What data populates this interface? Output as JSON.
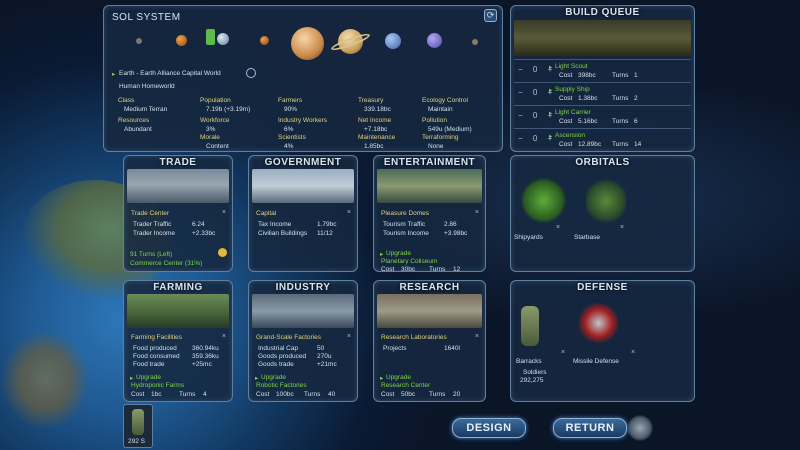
{
  "sol": {
    "title": "SOL SYSTEM",
    "planet_line": "Earth - Earth Alliance Capital World",
    "sub": "Human Homeworld",
    "stats": [
      {
        "l": "Class",
        "v": "Medium Terran"
      },
      {
        "l": "Population",
        "v": "7.19b (+3.19m)"
      },
      {
        "l": "Farmers",
        "v": "90%"
      },
      {
        "l": "Treasury",
        "v": "339.18bc"
      },
      {
        "l": "Ecology Control",
        "v": "Maintain"
      },
      {
        "l": "Resources",
        "v": "Abundant"
      },
      {
        "l": "Workforce",
        "v": "3%"
      },
      {
        "l": "Industry Workers",
        "v": "6%"
      },
      {
        "l": "Net Income",
        "v": "+7.18bc"
      },
      {
        "l": "Pollution",
        "v": "549u (Medium)"
      },
      {
        "l": "",
        "v": ""
      },
      {
        "l": "Morale",
        "v": "Content"
      },
      {
        "l": "Scientists",
        "v": "4%"
      },
      {
        "l": "Maintenance",
        "v": "1.85bc"
      },
      {
        "l": "Terraforming",
        "v": "None"
      }
    ]
  },
  "build": {
    "title": "BUILD QUEUE",
    "items": [
      {
        "name": "Light Scout",
        "cost": "Cost",
        "cv": "398bc",
        "turns": "Turns",
        "tv": "1",
        "ctl": "− 0 +"
      },
      {
        "name": "Supply Ship",
        "cost": "Cost",
        "cv": "1.38bc",
        "turns": "Turns",
        "tv": "2",
        "ctl": "− 0 +"
      },
      {
        "name": "Light Carrier",
        "cost": "Cost",
        "cv": "5.16bc",
        "turns": "Turns",
        "tv": "6",
        "ctl": "− 0 +"
      },
      {
        "name": "Ascension",
        "cost": "Cost",
        "cv": "12.89bc",
        "turns": "Turns",
        "tv": "14",
        "ctl": "− 0 +"
      }
    ]
  },
  "trade": {
    "title": "TRADE",
    "facility": "Trade Center",
    "r1l": "Trader Traffic",
    "r1v": "6.24",
    "r2l": "Trader Income",
    "r2v": "+2.33bc",
    "extra1": "91 Turns (Left)",
    "extra2": "Commerce Center (31%)"
  },
  "gov": {
    "title": "GOVERNMENT",
    "facility": "Capital",
    "r1l": "Tax Income",
    "r1v": "1.79bc",
    "r2l": "Civilian Buildings",
    "r2v": "11/12"
  },
  "ent": {
    "title": "ENTERTAINMENT",
    "facility": "Pleasure Domes",
    "r1l": "Tourism Traffic",
    "r1v": "2.86",
    "r2l": "Tourism Income",
    "r2v": "+3.98bc",
    "up": "Upgrade",
    "upname": "Planetary Coliseum",
    "cost": "Cost",
    "cv": "30bc",
    "turns": "Turns",
    "tv": "12"
  },
  "orb": {
    "title": "ORBITALS",
    "a": "Shipyards",
    "b": "Starbase"
  },
  "farm": {
    "title": "FARMING",
    "facility": "Farming Facilities",
    "r1l": "Food produced",
    "r1v": "360.94ku",
    "r2l": "Food consumed",
    "r2v": "359.36ku",
    "r3l": "Food trade",
    "r3v": "+25mc",
    "up": "Upgrade",
    "upname": "Hydroponic Farms",
    "cost": "Cost",
    "cv": "1bc",
    "turns": "Turns",
    "tv": "4"
  },
  "ind": {
    "title": "INDUSTRY",
    "facility": "Grand-Scale Factories",
    "r1l": "Industrial Cap",
    "r1v": "50",
    "r2l": "Goods produced",
    "r2v": "270u",
    "r3l": "Goods trade",
    "r3v": "+21mc",
    "up": "Upgrade",
    "upname": "Robotic Factories",
    "cost": "Cost",
    "cv": "100bc",
    "turns": "Turns",
    "tv": "40"
  },
  "res": {
    "title": "RESEARCH",
    "facility": "Research Laboratories",
    "r1l": "Projects",
    "r1v": "1640l",
    "up": "Upgrade",
    "upname": "Research Center",
    "cost": "Cost",
    "cv": "50bc",
    "turns": "Turns",
    "tv": "20"
  },
  "def": {
    "title": "DEFENSE",
    "a": "Barracks",
    "b": "Missile Defense",
    "sl": "Soldiers",
    "sv": "292,275"
  },
  "unit": {
    "count": "292 S"
  },
  "buttons": {
    "design": "DESIGN",
    "return": "RETURN"
  }
}
